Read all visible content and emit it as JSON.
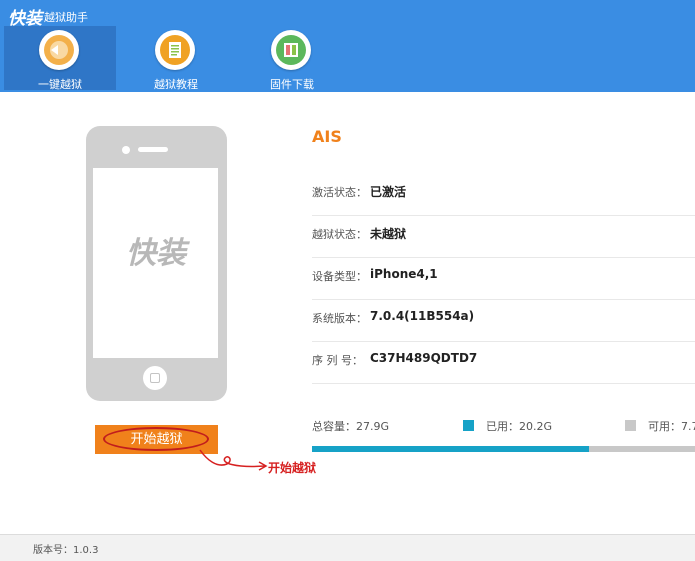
{
  "app": {
    "logo": "快装",
    "subtitle": "越狱助手"
  },
  "tabs": [
    {
      "label": "一键越狱",
      "icon": "jailbreak-icon",
      "active": true
    },
    {
      "label": "越狱教程",
      "icon": "tutorial-icon",
      "active": false
    },
    {
      "label": "固件下载",
      "icon": "firmware-download-icon",
      "active": false
    }
  ],
  "phone": {
    "screen_logo": "快装"
  },
  "start_button": {
    "label": "开始越狱"
  },
  "annotation": {
    "label": "开始越狱"
  },
  "device": {
    "name": "AIS",
    "rows": [
      {
        "key": "激活状态：",
        "value": "已激活"
      },
      {
        "key": "越狱状态：",
        "value": "未越狱"
      },
      {
        "key": "设备类型：",
        "value": "iPhone4,1"
      },
      {
        "key": "系统版本：",
        "value": "7.0.4(11B554a)"
      },
      {
        "key": "序 列 号：",
        "value": "C37H489QDTD7"
      }
    ]
  },
  "storage": {
    "total": "总容量：27.9G",
    "used": "已用：20.2G",
    "free": "可用：7.7",
    "used_fraction": 0.724,
    "used_color": "#16a2c7",
    "free_color": "#c8c8c8"
  },
  "footer": {
    "version": "版本号：1.0.3"
  },
  "colors": {
    "brand_blue": "#3a8de3",
    "accent_orange": "#f0811b",
    "annotation_red": "#d62020"
  }
}
